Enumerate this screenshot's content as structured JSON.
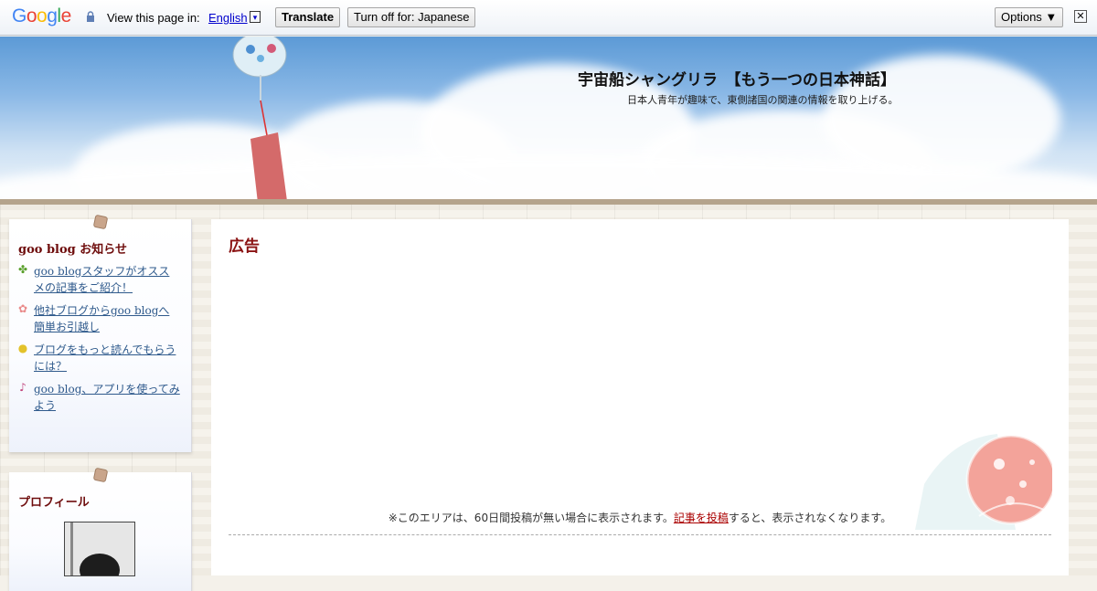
{
  "translate_bar": {
    "logo": "Google",
    "view_text": "View this page in:",
    "language": "English",
    "dropdown_glyph": "▾",
    "translate_label": "Translate",
    "turn_off_label": "Turn off for: Japanese",
    "options_label": "Options ▼",
    "close_glyph": "✕"
  },
  "header": {
    "title": "宇宙船シャングリラ　【もう一つの日本神話】",
    "description": "日本人青年が趣味で、東側諸国の関連の情報を取り上げる。"
  },
  "sidebar": {
    "news": {
      "heading": "goo blog お知らせ",
      "items": [
        {
          "icon": "clover-icon",
          "glyph": "✤",
          "color": "#5aa02c",
          "label": "goo blogスタッフがオススメの記事をご紹介！"
        },
        {
          "icon": "flower-icon",
          "glyph": "✿",
          "color": "#e98a8a",
          "label": "他社ブログからgoo blogへ簡単お引越し"
        },
        {
          "icon": "lightbulb-icon",
          "glyph": "💡",
          "color": "#e3c22b",
          "label": "ブログをもっと読んでもらうには？"
        },
        {
          "icon": "music-note-icon",
          "glyph": "♪",
          "color": "#c0427a",
          "label": "goo blog、アプリを使ってみよう"
        }
      ]
    },
    "profile": {
      "heading": "プロフィール"
    }
  },
  "main": {
    "ad_title": "広告",
    "note_before": "※このエリアは、60日間投稿が無い場合に表示されます。",
    "note_link": "記事を投稿",
    "note_after": "すると、表示されなくなります。"
  }
}
